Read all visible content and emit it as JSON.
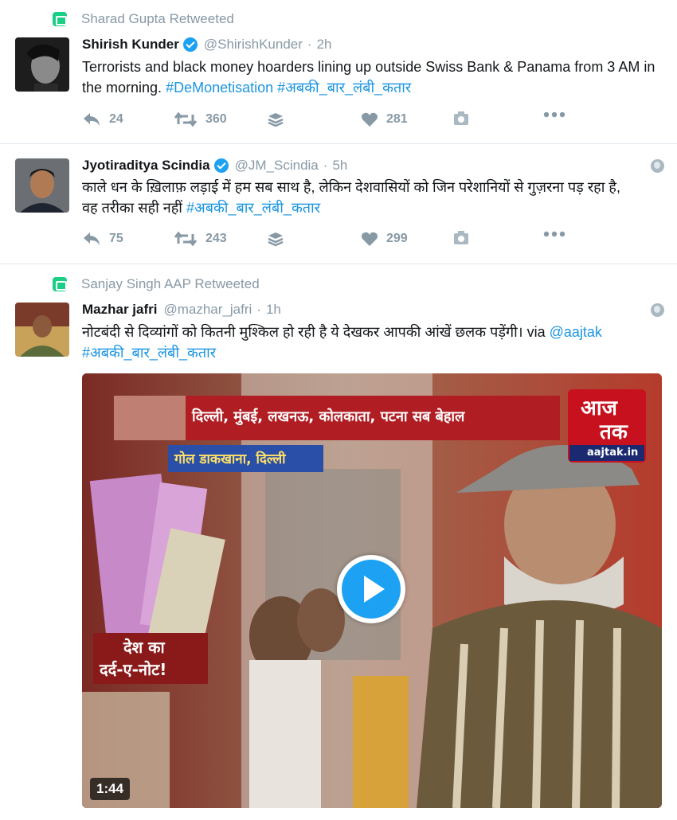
{
  "tweets": [
    {
      "retweeted_by": "Sharad Gupta Retweeted",
      "name": "Shirish Kunder",
      "handle": "@ShirishKunder",
      "time": "2h",
      "text_plain": "Terrorists and black money hoarders lining up outside Swiss Bank & Panama from 3 AM in the morning. ",
      "hashtag1": "#DeMonetisation",
      "hashtag2": "#अबकी_बार_लंबी_कतार",
      "replies": "24",
      "retweets": "360",
      "likes": "281"
    },
    {
      "name": "Jyotiraditya Scindia",
      "handle": "@JM_Scindia",
      "time": "5h",
      "text_plain": "काले धन के ख़िलाफ़ लड़ाई में हम सब साथ है, लेकिन देशवासियों को जिन परेशानियों से गुज़रना पड़ रहा है, वह तरीका सही नहीं ",
      "hashtag1": "#अबकी_बार_लंबी_कतार",
      "replies": "75",
      "retweets": "243",
      "likes": "299"
    },
    {
      "retweeted_by": "Sanjay Singh AAP Retweeted",
      "name": "Mazhar jafri",
      "handle": "@mazhar_jafri",
      "time": "1h",
      "text_plain": "नोटबंदी से दिव्यांगों को कितनी मुश्किल हो रही है ये देखकर आपकी आंखें छलक पड़ेंगी। via ",
      "mention": "@aajtak",
      "hashtag1": "#अबकी_बार_लंबी_कतार",
      "media": {
        "ticker": "दिल्ली, मुंबई, लखनऊ, कोलकाता, पटना सब बेहाल",
        "location": "गोल डाकखाना, दिल्ली",
        "logo_top": "आज",
        "logo_bottom": "तक",
        "logo_site": "aajtak.in",
        "caption_line1": "देश का",
        "caption_line2": "दर्द-ए-नोट!",
        "duration": "1:44"
      }
    }
  ],
  "colors": {
    "accent": "#1da1f2",
    "link": "#1b95e0",
    "muted": "#8899a6",
    "retweet_green": "#19cf86"
  }
}
